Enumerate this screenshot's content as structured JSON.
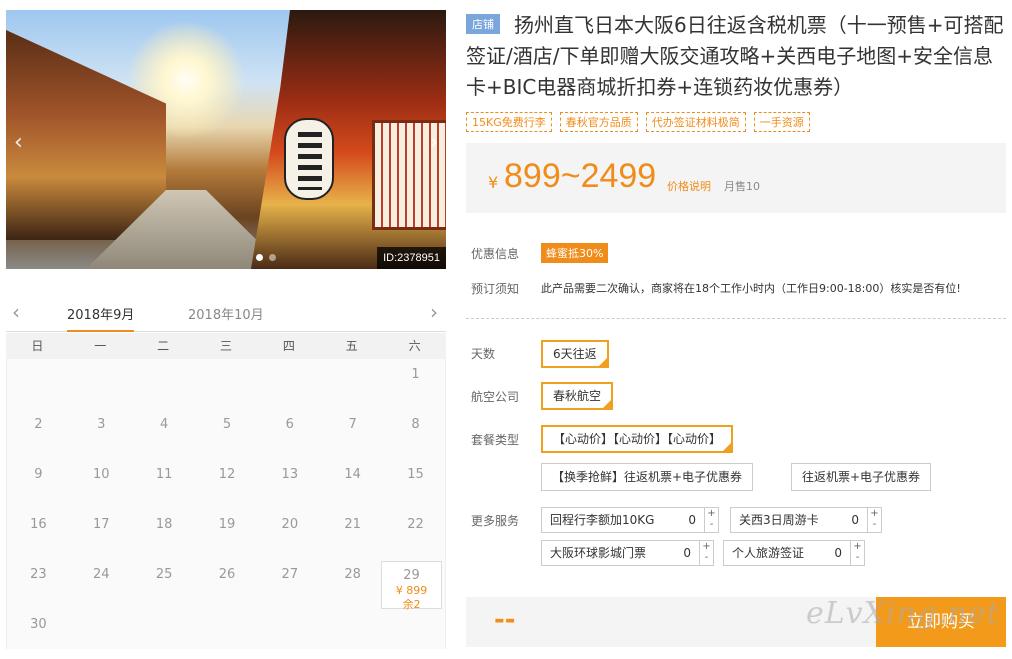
{
  "gallery": {
    "prev": "‹",
    "next": "›",
    "product_id": "ID:2378951"
  },
  "calendar": {
    "prev": "‹",
    "next": "›",
    "months": [
      "2018年9月",
      "2018年10月"
    ],
    "weekdays": [
      "日",
      "一",
      "二",
      "三",
      "四",
      "五",
      "六"
    ],
    "days": [
      "1",
      "2",
      "3",
      "4",
      "5",
      "6",
      "7",
      "8",
      "9",
      "10",
      "11",
      "12",
      "13",
      "14",
      "15",
      "16",
      "17",
      "18",
      "19",
      "20",
      "21",
      "22",
      "23",
      "24",
      "25",
      "26",
      "27",
      "28",
      "29",
      "30"
    ],
    "available": {
      "day": "29",
      "price": "¥ 899",
      "stock": "余2"
    }
  },
  "product": {
    "shop_tag": "店铺",
    "title": "扬州直飞日本大阪6日往返含税机票（十一预售+可搭配签证/酒店/下单即赠大阪交通攻略+关西电子地图+安全信息卡+BIC电器商城折扣券+连锁药妆优惠券）",
    "tags": [
      "15KG免费行李",
      "春秋官方品质",
      "代办签证材料极简",
      "一手资源"
    ],
    "price": {
      "currency": "¥",
      "value": "899~2499",
      "explain": "价格说明",
      "sold": "月售10"
    }
  },
  "info": {
    "promo_label": "优惠信息",
    "promo": "蜂蜜抵30%",
    "notice_label": "预订须知",
    "notice": "此产品需要二次确认，商家将在18个工作小时内（工作日9:00-18:00）核实是否有位!"
  },
  "options": {
    "days_label": "天数",
    "days": "6天往返",
    "airline_label": "航空公司",
    "airline": "春秋航空",
    "package_label": "套餐类型",
    "packages": [
      "【心动价】【心动价】【心动价】",
      "【换季抢鲜】往返机票+电子优惠券",
      "往返机票+电子优惠券"
    ],
    "services_label": "更多服务",
    "services": [
      {
        "name": "回程行李额加10KG",
        "qty": "0"
      },
      {
        "name": "关西3日周游卡",
        "qty": "0"
      },
      {
        "name": "大阪环球影城门票",
        "qty": "0"
      },
      {
        "name": "个人旅游签证",
        "qty": "0"
      }
    ]
  },
  "buy": {
    "price": "--",
    "button": "立即购买"
  },
  "watermark": "eLvXing.net",
  "colors": {
    "accent": "#f08c1a",
    "shop_tag": "#7aa6dc",
    "button": "#f39a1b"
  }
}
